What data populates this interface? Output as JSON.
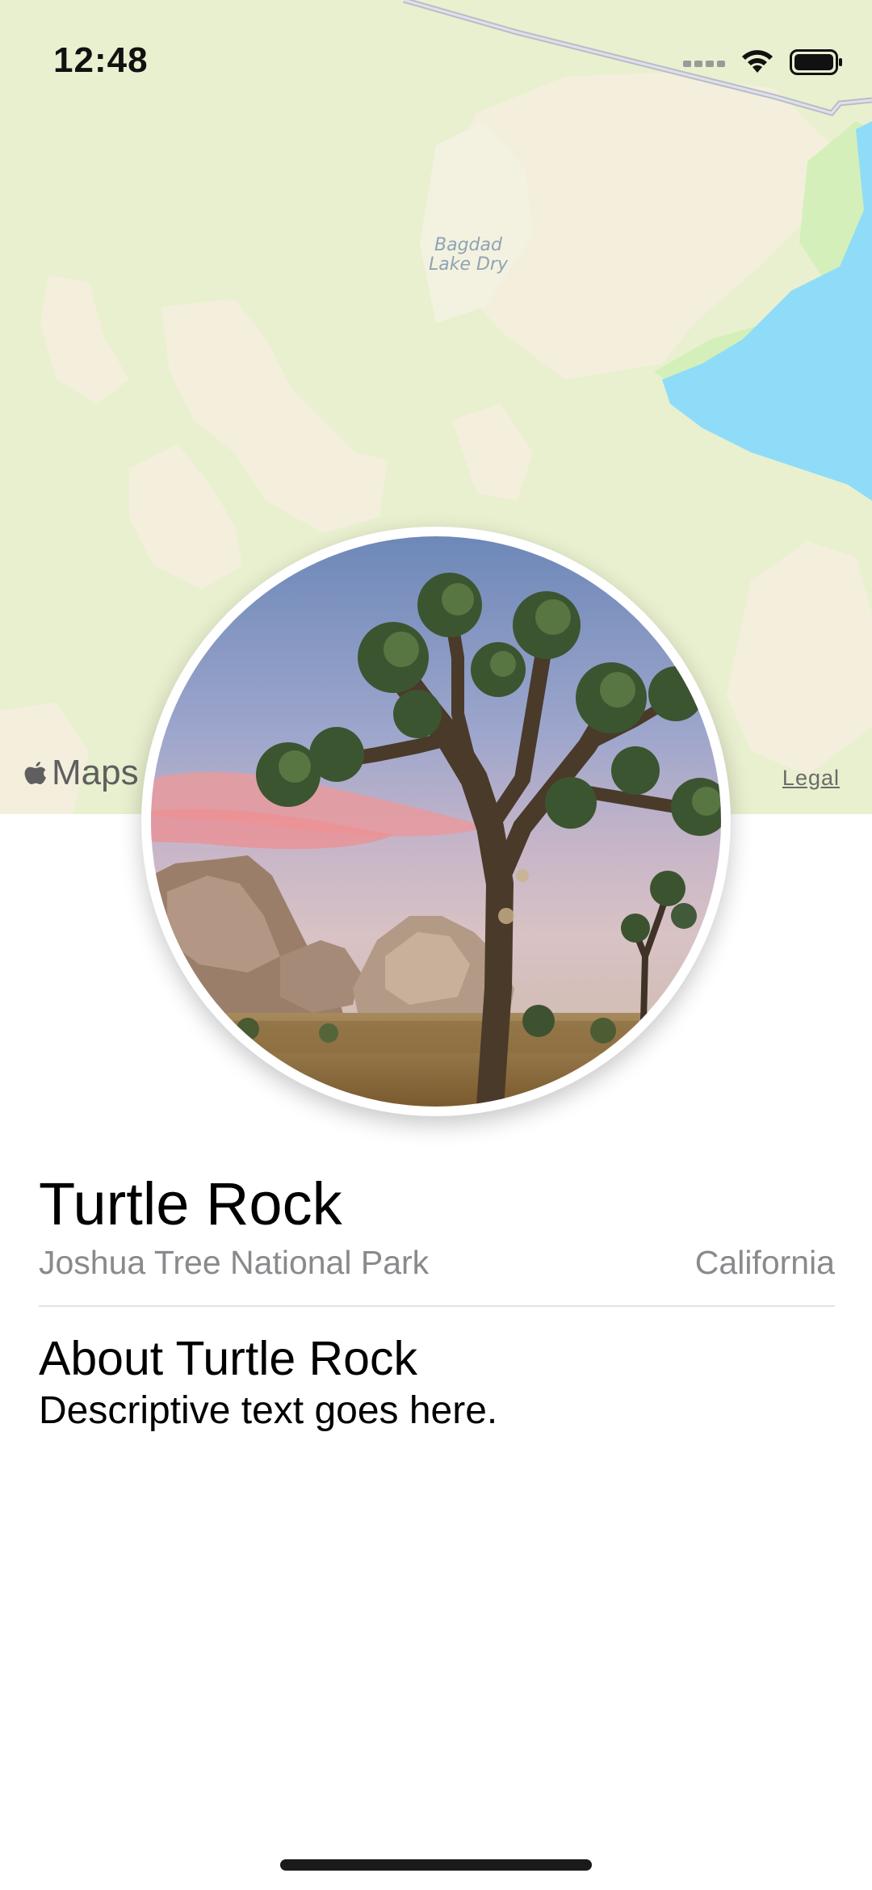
{
  "status_bar": {
    "time": "12:48",
    "icons": [
      "cellular-signal-icon",
      "wifi-icon",
      "battery-icon"
    ]
  },
  "map": {
    "place_label": "Bagdad Lake Dry",
    "attribution_logo": "Maps",
    "legal_link": "Legal",
    "colors": {
      "land": "#e9f0cf",
      "desert": "#f4efdc",
      "water": "#8fdcf8",
      "road": "#b9bcc9"
    }
  },
  "landmark": {
    "name": "Turtle Rock",
    "park": "Joshua Tree National Park",
    "state": "California",
    "about_title": "About Turtle Rock",
    "description": "Descriptive text goes here."
  },
  "colors": {
    "secondary_text": "#8a8a8e",
    "divider": "#e3e3e6"
  }
}
